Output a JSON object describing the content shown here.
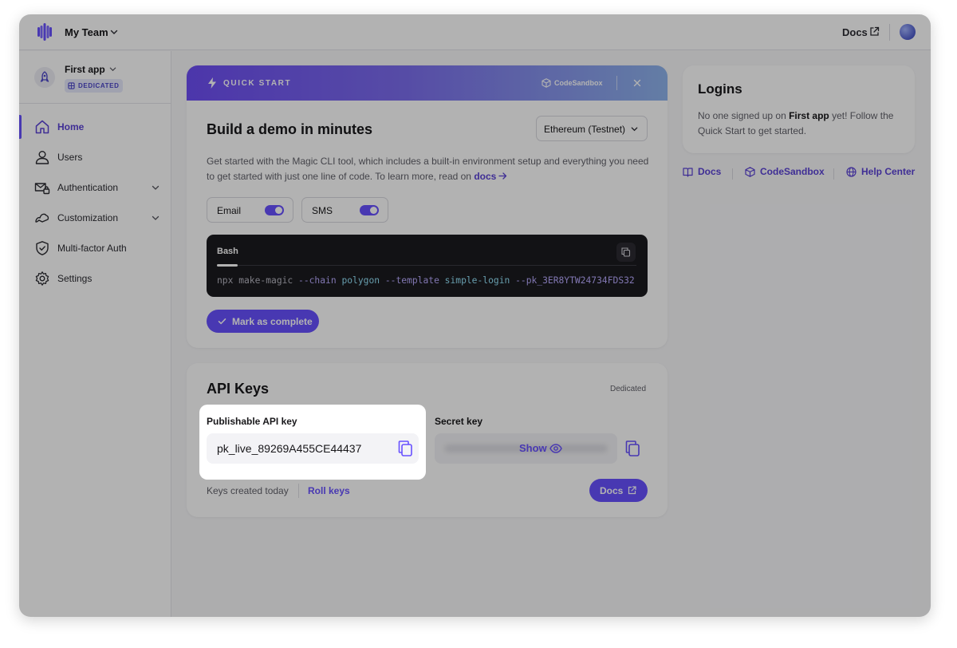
{
  "topbar": {
    "team_name": "My Team",
    "docs_label": "Docs"
  },
  "sidebar": {
    "app_name": "First app",
    "app_badge": "DEDICATED",
    "items": [
      {
        "label": "Home",
        "active": true
      },
      {
        "label": "Users"
      },
      {
        "label": "Authentication",
        "expandable": true
      },
      {
        "label": "Customization",
        "expandable": true
      },
      {
        "label": "Multi-factor Auth"
      },
      {
        "label": "Settings"
      }
    ]
  },
  "quick_start": {
    "header_label": "QUICK START",
    "codesandbox_label": "CodeSandbox",
    "title": "Build a demo in minutes",
    "network_select": "Ethereum (Testnet)",
    "description": "Get started with the Magic CLI tool, which includes a built-in environment setup and everything you need to get started with just one line of code. To learn more, read on ",
    "docs_link": "docs",
    "toggles": [
      {
        "label": "Email",
        "on": true
      },
      {
        "label": "SMS",
        "on": true
      }
    ],
    "code_tab": "Bash",
    "code": {
      "cmd": "npx make-magic ",
      "flag1": "--chain",
      "val1": " polygon ",
      "flag2": "--template",
      "val2": " simple-login ",
      "flag3": "--pk_3ER8YTW24734FDS32"
    },
    "mark_complete": "Mark as complete"
  },
  "logins": {
    "title": "Logins",
    "text_pre": "No one signed up on ",
    "app_name": "First app",
    "text_post": " yet! Follow the Quick Start to get started."
  },
  "links": [
    {
      "label": "Docs",
      "icon": "book-icon"
    },
    {
      "label": "CodeSandbox",
      "icon": "cube-icon"
    },
    {
      "label": "Help Center",
      "icon": "globe-icon"
    }
  ],
  "api_keys": {
    "title": "API Keys",
    "dedicated": "Dedicated",
    "publishable_label": "Publishable API key",
    "publishable_value": "pk_live_89269A455CE44437",
    "secret_label": "Secret key",
    "show_label": "Show",
    "created": "Keys created today",
    "roll": "Roll keys",
    "docs_btn": "Docs"
  },
  "colors": {
    "accent": "#6851ff",
    "accent_text": "#5b43d6"
  }
}
